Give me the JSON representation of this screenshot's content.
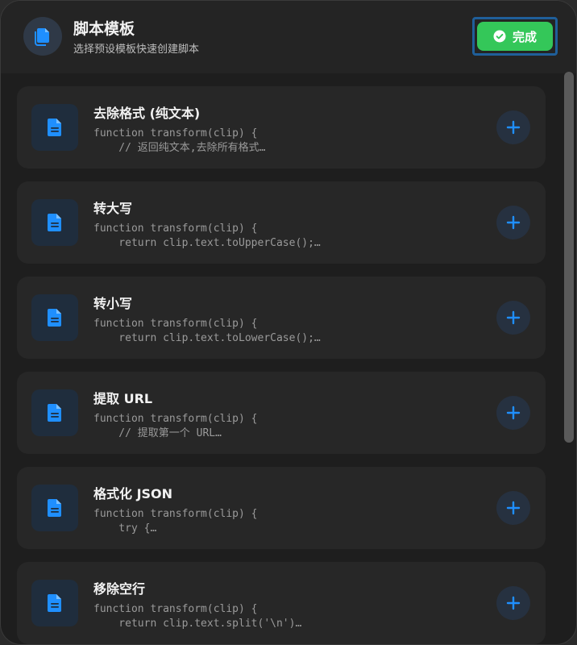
{
  "header": {
    "icon": "document-stack-icon",
    "title": "脚本模板",
    "subtitle": "选择预设模板快速创建脚本",
    "done_label": "完成",
    "done_icon": "checkmark-circle-icon",
    "done_color": "#34c759"
  },
  "accent_color": "#1f8fff",
  "templates": [
    {
      "name": "去除格式 (纯文本)",
      "code_line1": "function transform(clip) {",
      "code_line2": "    // 返回纯文本,去除所有格式…",
      "icon": "document-icon",
      "add_icon": "plus-icon"
    },
    {
      "name": "转大写",
      "code_line1": "function transform(clip) {",
      "code_line2": "    return clip.text.toUpperCase();…",
      "icon": "document-icon",
      "add_icon": "plus-icon"
    },
    {
      "name": "转小写",
      "code_line1": "function transform(clip) {",
      "code_line2": "    return clip.text.toLowerCase();…",
      "icon": "document-icon",
      "add_icon": "plus-icon"
    },
    {
      "name": "提取 URL",
      "code_line1": "function transform(clip) {",
      "code_line2": "    // 提取第一个 URL…",
      "icon": "document-icon",
      "add_icon": "plus-icon"
    },
    {
      "name": "格式化 JSON",
      "code_line1": "function transform(clip) {",
      "code_line2": "    try {…",
      "icon": "document-icon",
      "add_icon": "plus-icon"
    },
    {
      "name": "移除空行",
      "code_line1": "function transform(clip) {",
      "code_line2": "    return clip.text.split('\\n')…",
      "icon": "document-icon",
      "add_icon": "plus-icon"
    }
  ]
}
